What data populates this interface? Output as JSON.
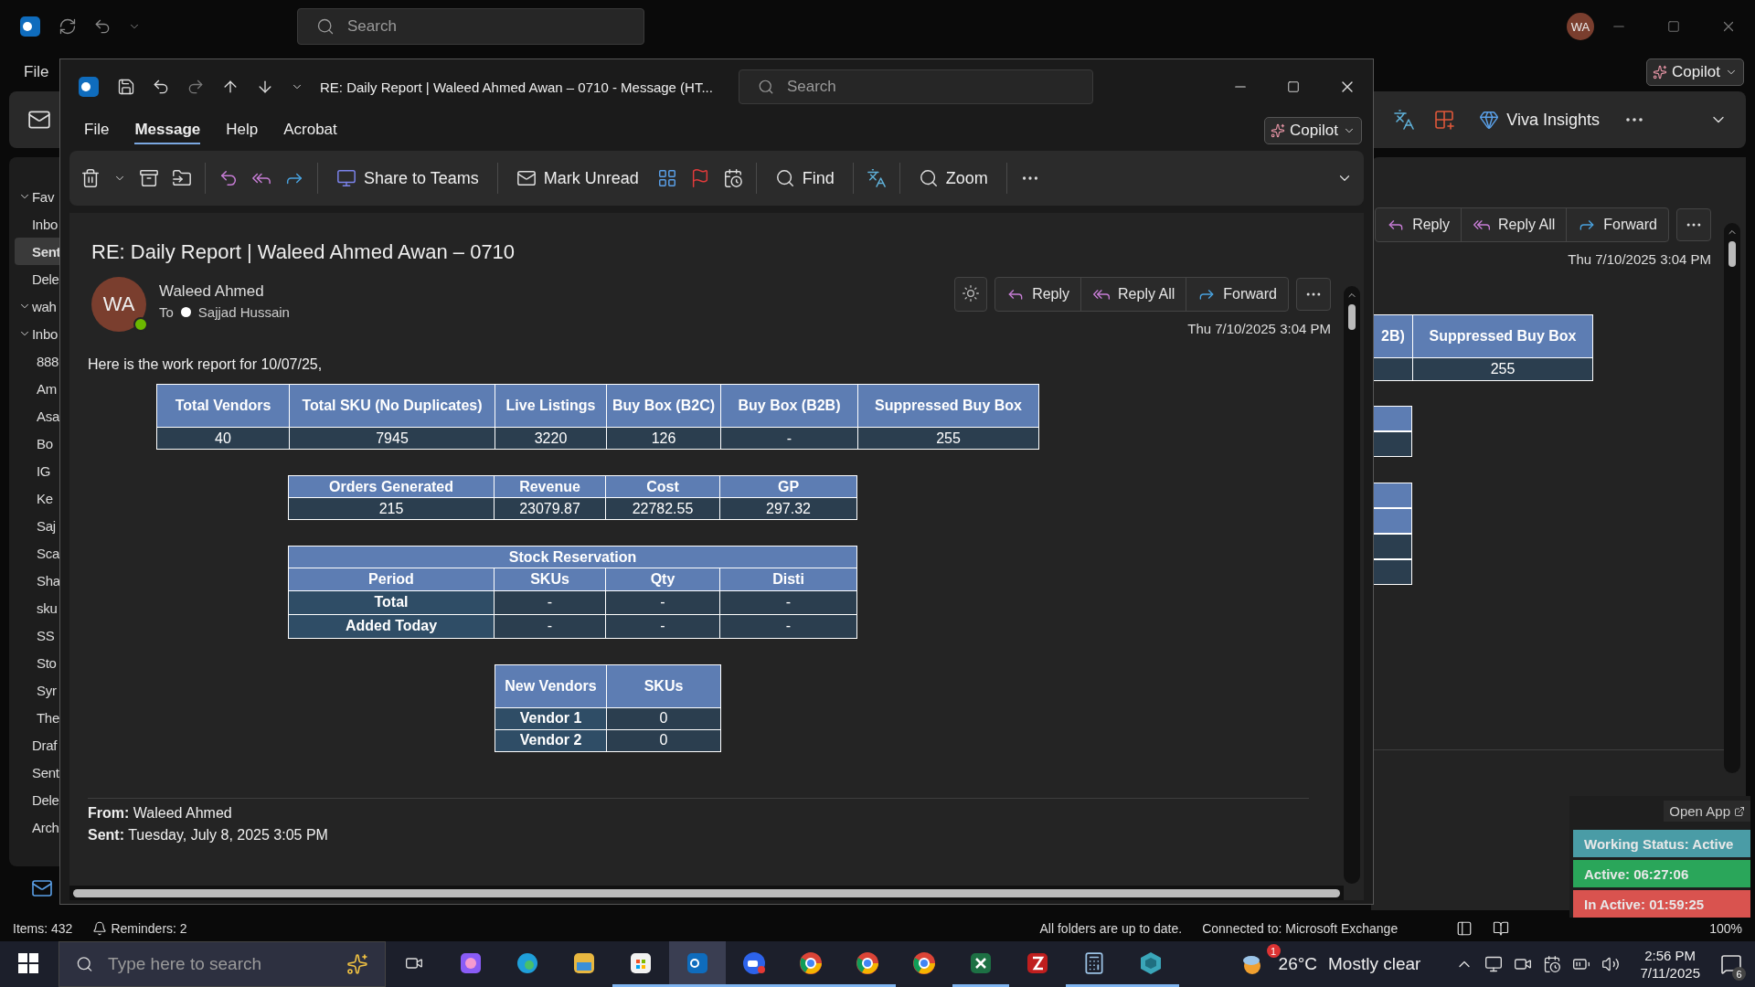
{
  "app_titlebar": {
    "search_placeholder": "Search",
    "avatar": "WA"
  },
  "app_menu": {
    "file": "File",
    "copilot": "Copilot"
  },
  "app_ribbon": {
    "viva": "Viva Insights"
  },
  "sidebar": {
    "items": [
      {
        "label": "Fav",
        "kind": "group",
        "expanded": true,
        "selected": false,
        "children": [
          {
            "label": "Inbo",
            "kind": "folder",
            "selected": false
          },
          {
            "label": "Sent",
            "kind": "folder",
            "selected": true
          },
          {
            "label": "Dele",
            "kind": "folder",
            "selected": false
          }
        ]
      },
      {
        "label": "wah",
        "kind": "group",
        "expanded": true,
        "selected": false,
        "children": [
          {
            "label": "Inbo",
            "kind": "group",
            "expanded": true,
            "selected": false,
            "children": [
              {
                "label": "888",
                "kind": "folder",
                "selected": false
              },
              {
                "label": "Am",
                "kind": "folder",
                "selected": false
              },
              {
                "label": "Asa",
                "kind": "folder",
                "selected": false
              },
              {
                "label": "Bo",
                "kind": "folder",
                "selected": false
              },
              {
                "label": "IG",
                "kind": "folder",
                "selected": false
              },
              {
                "label": "Ke",
                "kind": "folder",
                "selected": false
              },
              {
                "label": "Saj",
                "kind": "folder",
                "selected": false
              },
              {
                "label": "Sca",
                "kind": "folder",
                "selected": false
              },
              {
                "label": "Sha",
                "kind": "folder",
                "selected": false
              },
              {
                "label": "sku",
                "kind": "folder",
                "selected": false
              },
              {
                "label": "SS",
                "kind": "folder",
                "selected": false
              },
              {
                "label": "Sto",
                "kind": "folder",
                "selected": false
              },
              {
                "label": "Syr",
                "kind": "folder",
                "selected": false
              },
              {
                "label": "The",
                "kind": "folder",
                "selected": false
              }
            ]
          },
          {
            "label": "Draf",
            "kind": "folder",
            "selected": false
          },
          {
            "label": "Sent",
            "kind": "folder",
            "selected": false
          },
          {
            "label": "Dele",
            "kind": "folder",
            "selected": false
          },
          {
            "label": "Arch",
            "kind": "folder",
            "selected": false
          }
        ]
      }
    ]
  },
  "reading_pane": {
    "actions": [
      "Reply",
      "Reply All",
      "Forward"
    ],
    "date": "Thu 7/10/2025 3:04 PM",
    "table_fragment": {
      "headers": [
        "2B)",
        "Suppressed Buy Box"
      ],
      "value": "255"
    }
  },
  "message_window": {
    "title": "RE: Daily Report | Waleed Ahmed Awan – 0710  -  Message (HT...",
    "search_placeholder": "Search",
    "tabs": [
      {
        "label": "File",
        "selected": false
      },
      {
        "label": "Message",
        "selected": true
      },
      {
        "label": "Help",
        "selected": false
      },
      {
        "label": "Acrobat",
        "selected": false
      }
    ],
    "copilot": "Copilot",
    "ribbon": {
      "share": "Share to Teams",
      "mark_unread": "Mark Unread",
      "find": "Find",
      "zoom": "Zoom"
    },
    "subject": "RE: Daily Report | Waleed Ahmed Awan – 0710",
    "sender": {
      "name": "Waleed Ahmed",
      "initials": "WA",
      "online": true
    },
    "to_label": "To",
    "recipient": "Sajjad Hussain",
    "actions": [
      "Reply",
      "Reply All",
      "Forward"
    ],
    "date": "Thu 7/10/2025 3:04 PM",
    "intro": "Here is the work report for 10/07/25,",
    "tables": [
      {
        "columns": [
          "Total Vendors",
          "Total SKU (No Duplicates)",
          "Live Listings",
          "Buy Box (B2C)",
          "Buy Box (B2B)",
          "Suppressed Buy Box"
        ],
        "rows": [
          {
            "cells": [
              "40",
              "7945",
              "3220",
              "126",
              "-",
              "255"
            ]
          }
        ]
      },
      {
        "columns": [
          "Orders Generated",
          "Revenue",
          "Cost",
          "GP"
        ],
        "rows": [
          {
            "cells": [
              "215",
              "23079.87",
              "22782.55",
              "297.32"
            ]
          }
        ]
      },
      {
        "title": "Stock Reservation",
        "row_headers": true,
        "columns": [
          "Period",
          "SKUs",
          "Qty",
          "Disti"
        ],
        "rows": [
          {
            "cells": [
              "Total",
              "-",
              "-",
              "-"
            ]
          },
          {
            "cells": [
              "Added Today",
              "-",
              "-",
              "-"
            ]
          }
        ]
      },
      {
        "row_headers": true,
        "columns": [
          "New Vendors",
          "SKUs"
        ],
        "rows": [
          {
            "cells": [
              "Vendor 1",
              "0"
            ]
          },
          {
            "cells": [
              "Vendor 2",
              "0"
            ]
          }
        ]
      }
    ],
    "from_label": "From:",
    "from": "Waleed Ahmed",
    "sent_label": "Sent:",
    "sent": "Tuesday, July 8, 2025 3:05 PM"
  },
  "status_bar": {
    "items": "Items: 432",
    "reminders": "Reminders: 2",
    "sync": "All folders are up to date.",
    "connection": "Connected to: Microsoft Exchange",
    "zoom": "100%"
  },
  "status_widget": {
    "open_app": "Open App",
    "statuses": [
      {
        "label": "Working Status: Active",
        "color": "#4a9ca6"
      },
      {
        "label": "Active: 06:27:06",
        "color": "#2aa65a"
      },
      {
        "label": "In Active: 01:59:25",
        "color": "#d9534f"
      }
    ]
  },
  "taskbar": {
    "search_placeholder": "Type here to search",
    "apps": [
      {
        "selected": false,
        "running": false
      },
      {
        "selected": false,
        "running": false
      },
      {
        "selected": false,
        "running": false
      },
      {
        "selected": false,
        "running": false
      },
      {
        "selected": false,
        "running": true
      },
      {
        "selected": true,
        "running": true
      },
      {
        "selected": false,
        "running": true
      },
      {
        "selected": false,
        "running": true
      },
      {
        "selected": false,
        "running": true
      },
      {
        "selected": false,
        "running": false
      },
      {
        "selected": false,
        "running": true
      },
      {
        "selected": false,
        "running": false
      },
      {
        "selected": false,
        "running": true
      },
      {
        "selected": false,
        "running": true
      }
    ],
    "weather": {
      "badge": "1",
      "temp": "26°C",
      "desc": "Mostly clear"
    },
    "time": "2:56 PM",
    "date": "7/11/2025",
    "notifications": "6"
  }
}
